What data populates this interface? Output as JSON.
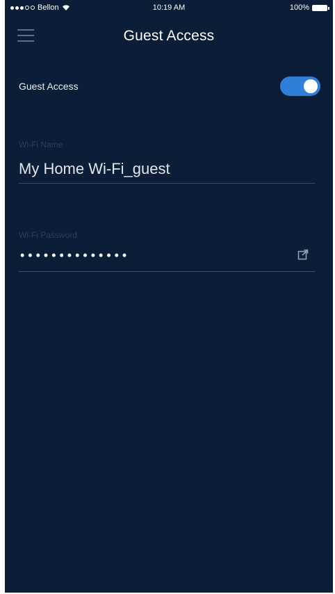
{
  "status_bar": {
    "carrier": "Bellon",
    "time": "10:19 AM",
    "battery": "100%"
  },
  "header": {
    "title": "Guest Access",
    "menu_icon": "hamburger-menu-icon"
  },
  "guest_access": {
    "label": "Guest Access",
    "enabled": true,
    "toggle_color": "#2f7fd9"
  },
  "wifi_name": {
    "label": "Wi-Fi Name",
    "value": "My Home Wi-Fi_guest"
  },
  "wifi_password": {
    "label": "Wi-Fi Password",
    "masked_value": "••••••••••••••",
    "share_icon": "share-icon"
  },
  "colors": {
    "background": "#0c1e37",
    "accent": "#2f7fd9",
    "divider": "#3b4e69"
  }
}
